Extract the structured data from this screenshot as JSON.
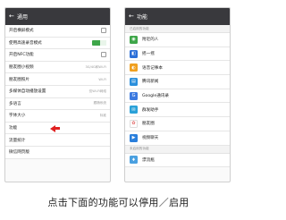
{
  "left": {
    "back_icon": "back-arrow-icon",
    "title": "通用",
    "rows": [
      {
        "label": "开启横屏模式",
        "control": "checkbox"
      },
      {
        "label": "使用高速录音模式",
        "control": "toggle-on"
      },
      {
        "label": "开启NFC功能",
        "control": "checkbox"
      },
      {
        "label": "朋友圈小视频",
        "value": "3G/4G和Wi-Fi"
      },
      {
        "label": "朋友圈照片",
        "value": "Wi-Fi"
      },
      {
        "label": "多媒体自动播放设置",
        "value": "仅Wi-Fi网络"
      },
      {
        "label": "多语言",
        "value": "跟随系统"
      },
      {
        "label": "字体大小",
        "value": "标准"
      },
      {
        "label": "功能",
        "control": "arrow"
      },
      {
        "label": "流量统计"
      },
      {
        "label": "微信网页版"
      }
    ],
    "highlight_color": "#e02020"
  },
  "right": {
    "back_icon": "back-arrow-icon",
    "title": "功能",
    "enabled_section": "已启用的功能",
    "enabled": [
      {
        "label": "附近的人",
        "icon": "location-icon",
        "color": "#3ea649",
        "glyph": "◉"
      },
      {
        "label": "摇一摇",
        "icon": "shake-icon",
        "color": "#2a6fd8",
        "glyph": "◧"
      },
      {
        "label": "语音记事本",
        "icon": "voice-note-icon",
        "color": "#f0a020",
        "glyph": "◐"
      },
      {
        "label": "腾讯新闻",
        "icon": "news-icon",
        "color": "#2a8fdc",
        "glyph": "▤"
      },
      {
        "label": "Google通讯录",
        "icon": "google-contacts-icon",
        "color": "#3c7ae0",
        "glyph": "G"
      },
      {
        "label": "群发助手",
        "icon": "broadcast-icon",
        "color": "#2aa1d8",
        "glyph": "✉"
      },
      {
        "label": "朋友圈",
        "icon": "moments-icon",
        "color": "#ffffff",
        "glyph": "✿"
      },
      {
        "label": "视频聊天",
        "icon": "video-chat-icon",
        "color": "#2a7fdc",
        "glyph": "▶"
      }
    ],
    "disabled_section": "未启用的功能",
    "disabled": [
      {
        "label": "漂流瓶",
        "icon": "drift-bottle-icon",
        "color": "#4aa0e0",
        "glyph": "♦"
      }
    ]
  },
  "caption": "点击下面的功能可以停用／启用"
}
